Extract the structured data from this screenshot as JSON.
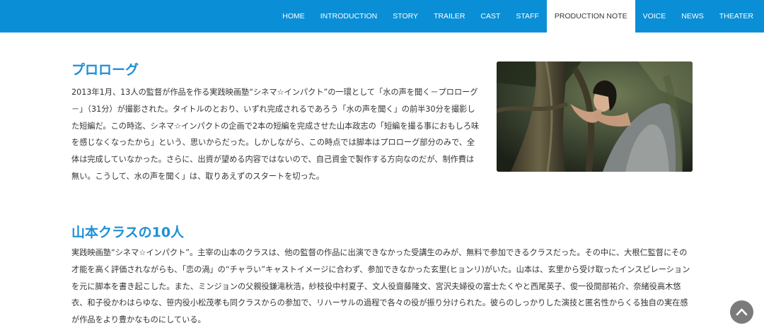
{
  "nav": {
    "items": [
      {
        "label": "HOME"
      },
      {
        "label": "INTRODUCTION"
      },
      {
        "label": "STORY"
      },
      {
        "label": "TRAILER"
      },
      {
        "label": "CAST"
      },
      {
        "label": "STAFF"
      },
      {
        "label": "PRODUCTION NOTE",
        "active": true
      },
      {
        "label": "VOICE"
      },
      {
        "label": "NEWS"
      },
      {
        "label": "THEATER"
      }
    ]
  },
  "section1": {
    "title": "プロローグ",
    "body": "2013年1月、13人の監督が作品を作る実践映画塾“シネマ☆インパクト”の一環として「水の声を聞く－プロローグ－」（31分）が撮影された。タイトルのとおり、いずれ完成されるであろう「水の声を聞く」の前半30分を撮影した短編だ。この時迄、シネマ☆インパクトの企画で2本の短編を完成させた山本政志の「短編を撮る事におもしろ味を感じなくなったから」という、思いからだった。しかしながら、この時点では脚本はプロローグ部分のみで、全体は完成していなかった。さらに、出資が望める内容ではないので、自己資金で製作する方向なのだが、制作費は無い。こうして、水の声を聞く」は、取りあえずのスタートを切った。"
  },
  "section2": {
    "title": "山本クラスの10人",
    "body": "実践映画塾“シネマ☆インパクト”。主宰の山本のクラスは、他の監督の作品に出演できなかった受講生のみが、無料で参加できるクラスだった。その中に、大根仁監督にその才能を高く評価されながらも、「恋の渦」の“チャラい”キャストイメージに合わず、参加できなかった玄里(ヒョンリ)がいた。山本は、玄里から受け取ったインスピレーションを元に脚本を書き起こした。また、ミンジョンの父親役鎌滝秋浩，紗枝役中村夏子、文人役齋藤隆文、宮沢夫婦役の富士たくやと西尾英子、俊一役間部祐介、奈緒役高木悠衣、和子役かわはらゆな、笹内役小松茂孝も同クラスからの参加で、リハーサルの過程で各々の役が振り分けられた。彼らのしっかりした演技と匿名性からくる独自の実在感が作品をより豊かなものにしている。"
  },
  "colors": {
    "nav_bg": "#0a8fd7",
    "title": "#1e8fd6",
    "text": "#333333",
    "scroll_button": "#7b7b7b"
  },
  "icons": {
    "scroll_top": "chevron-up-icon"
  }
}
